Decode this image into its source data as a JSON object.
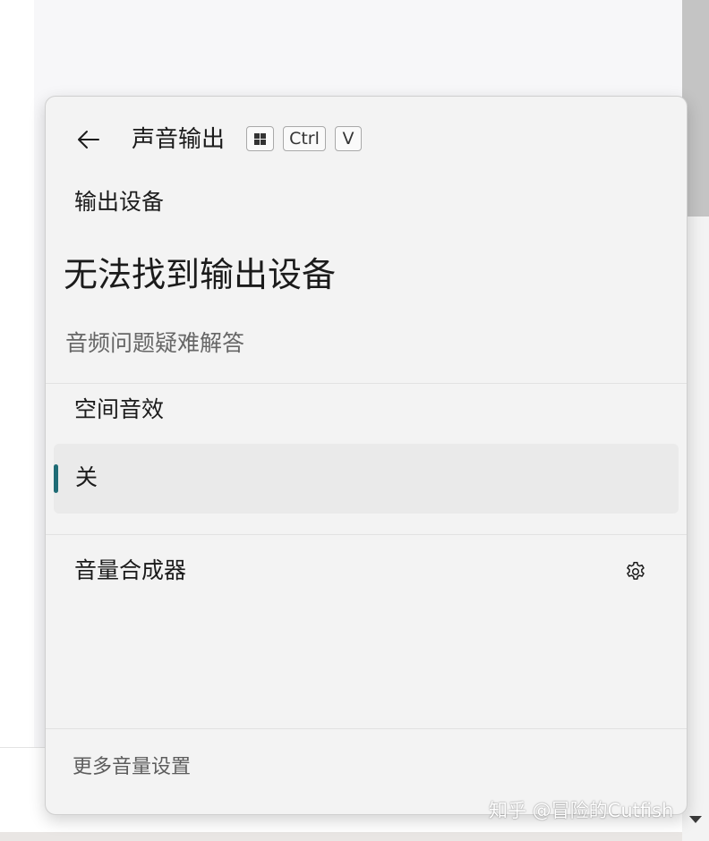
{
  "flyout": {
    "title": "声音输出",
    "shortcut_keys": [
      "Ctrl",
      "V"
    ],
    "output_device_heading": "输出设备",
    "no_device_message": "无法找到输出设备",
    "troubleshoot_link": "音频问题疑难解答",
    "spatial_sound_heading": "空间音效",
    "spatial_sound_selected": "关",
    "volume_mixer_label": "音量合成器",
    "more_settings_link": "更多音量设置"
  },
  "icons": {
    "back": "back-arrow-icon",
    "windows_key": "windows-logo-icon",
    "settings": "gear-icon"
  },
  "colors": {
    "accent": "#1f6b75",
    "flyout_background": "#f3f3f3"
  },
  "watermark": "知乎 @冒险的Cutfish"
}
